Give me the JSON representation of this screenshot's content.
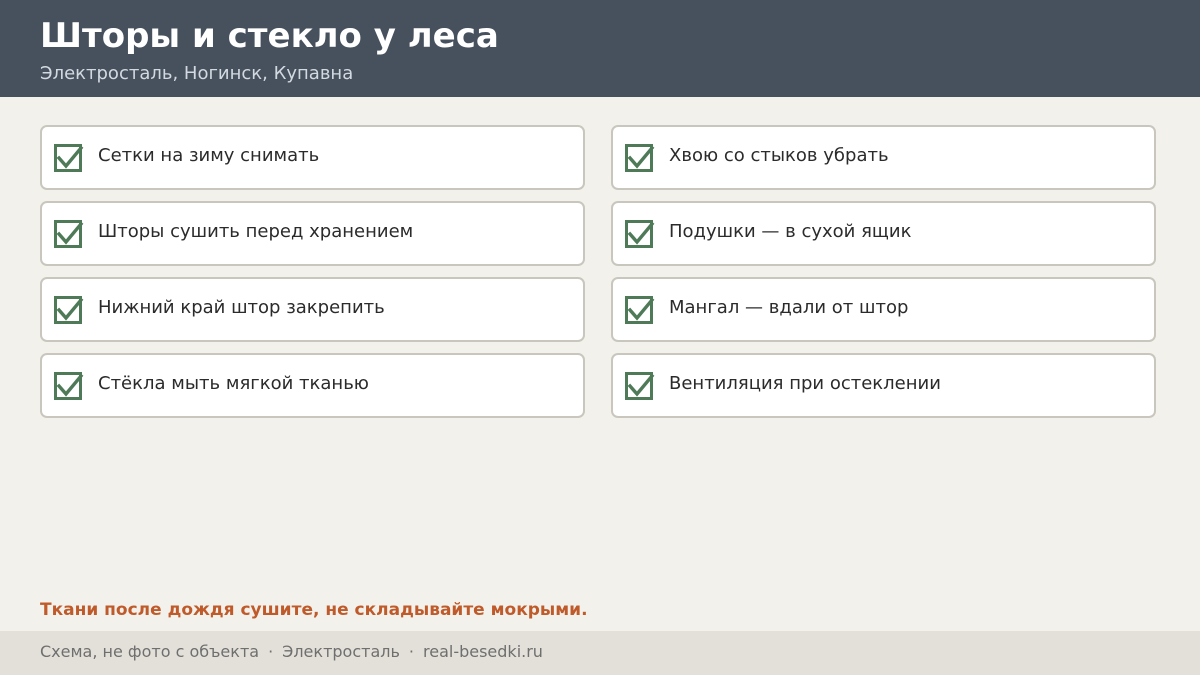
{
  "header": {
    "title": "Шторы и стекло у леса",
    "subtitle": "Электросталь, Ногинск, Купавна"
  },
  "checklist": {
    "left": [
      {
        "label": "Сетки на зиму снимать",
        "checked": true
      },
      {
        "label": "Шторы сушить перед хранением",
        "checked": true
      },
      {
        "label": "Нижний край штор закрепить",
        "checked": true
      },
      {
        "label": "Стёкла мыть мягкой тканью",
        "checked": true
      }
    ],
    "right": [
      {
        "label": "Хвою со стыков убрать",
        "checked": true
      },
      {
        "label": "Подушки — в сухой ящик",
        "checked": true
      },
      {
        "label": "Мангал — вдали от штор",
        "checked": true
      },
      {
        "label": "Вентиляция при остеклении",
        "checked": true
      }
    ],
    "check_icon": "checkbox-checked-icon",
    "check_color": "#4e7a58"
  },
  "note": "Ткани после дождя сушите, не складывайте мокрыми.",
  "footer": {
    "parts": [
      "Схема, не фото с объекта",
      "Электросталь",
      "real-besedki.ru"
    ],
    "separator": "·"
  },
  "colors": {
    "header_bg": "#47515e",
    "page_bg": "#f3f1ec",
    "accent": "#bf5a2a",
    "footer_bg": "#e3e0d9"
  }
}
